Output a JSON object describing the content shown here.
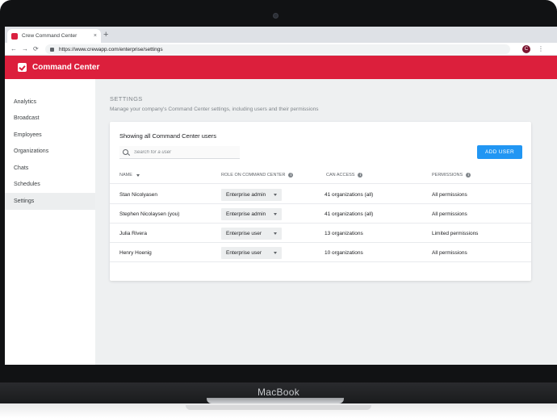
{
  "device": {
    "label": "MacBook"
  },
  "browser": {
    "tab_title": "Crew Command Center",
    "tab_close": "×",
    "new_tab": "+",
    "url": "https://www.crewapp.com/enterprise/settings",
    "back": "←",
    "forward": "→",
    "reload": "⟳",
    "profile_initial": "C",
    "menu": "⋮"
  },
  "app": {
    "title": "Command Center",
    "accent": "#dc1f3c"
  },
  "sidebar": {
    "items": [
      {
        "label": "Analytics"
      },
      {
        "label": "Broadcast"
      },
      {
        "label": "Employees"
      },
      {
        "label": "Organizations"
      },
      {
        "label": "Chats"
      },
      {
        "label": "Schedules"
      },
      {
        "label": "Settings",
        "active": true
      }
    ]
  },
  "main": {
    "heading": "SETTINGS",
    "description": "Manage your company's Command Center settings, including users and their permissions",
    "card": {
      "title": "Showing all Command Center users",
      "search_placeholder": "Search for a user",
      "add_button": "ADD USER",
      "columns": {
        "name": "NAME",
        "role": "ROLE ON COMMAND CENTER",
        "access": "CAN ACCESS",
        "permissions": "PERMISSIONS"
      },
      "rows": [
        {
          "name": "Stan Nicolyasen",
          "role": "Enterprise admin",
          "access": "41 organizations (all)",
          "permissions": "All permissions"
        },
        {
          "name": "Stephen Nicolaysen (you)",
          "role": "Enterprise admin",
          "access": "41 organizations (all)",
          "permissions": "All permissions"
        },
        {
          "name": "Julia Rivera",
          "role": "Enterprise user",
          "access": "13 organizations",
          "permissions": "Limited permissions"
        },
        {
          "name": "Henry Hoenig",
          "role": "Enterprise user",
          "access": "10 organizations",
          "permissions": "All permissions"
        }
      ]
    }
  }
}
